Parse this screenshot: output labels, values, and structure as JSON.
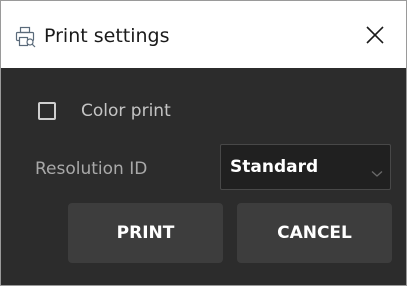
{
  "window": {
    "title": "Print settings",
    "title_icon": "print-settings-icon",
    "close_icon": "close-icon"
  },
  "options": {
    "color_print": {
      "label": "Color print",
      "checked": false
    },
    "resolution": {
      "label": "Resolution ID",
      "selected": "Standard",
      "chevron_icon": "chevron-down-icon"
    }
  },
  "actions": {
    "print_label": "PRINT",
    "cancel_label": "CANCEL"
  },
  "colors": {
    "panel_background": "#2c2c2c",
    "button_background": "#3d3d3d",
    "select_background": "#202020",
    "titlebar_background": "#ffffff"
  }
}
